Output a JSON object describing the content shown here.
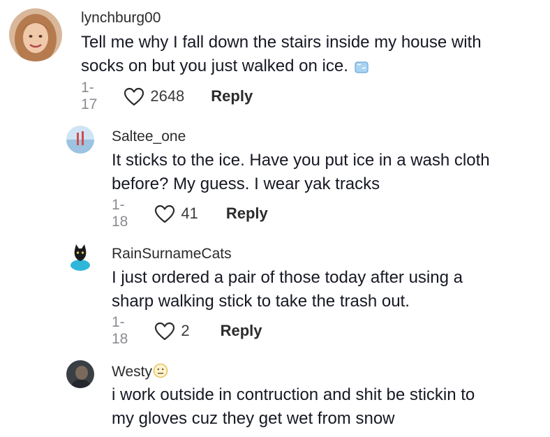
{
  "comments": [
    {
      "username": "lynchburg00",
      "text_lines": [
        "Tell me why I fall down the stairs inside my house with",
        "socks on but you just walked on ice."
      ],
      "emoji": "ice-cube-icon",
      "date": "1-17",
      "likes": "2648",
      "reply_label": "Reply"
    },
    {
      "username": "Saltee_one",
      "text_lines": [
        "It sticks to the ice. Have you put ice in a wash cloth",
        "before? My guess. I wear yak tracks"
      ],
      "date": "1-18",
      "likes": "41",
      "reply_label": "Reply"
    },
    {
      "username": "RainSurnameCats",
      "text_lines": [
        "I just ordered a pair of those today after using a",
        "sharp walking stick to take the trash out."
      ],
      "date": "1-18",
      "likes": "2",
      "reply_label": "Reply"
    },
    {
      "username": "Westy",
      "username_emoji": "neutral-face-icon",
      "text_lines": [
        "i work outside in contruction and shit be stickin to",
        "my gloves cuz they get wet from snow"
      ]
    }
  ],
  "colors": {
    "text": "#161823",
    "secondary": "#8a8b91",
    "background": "#ffffff"
  }
}
